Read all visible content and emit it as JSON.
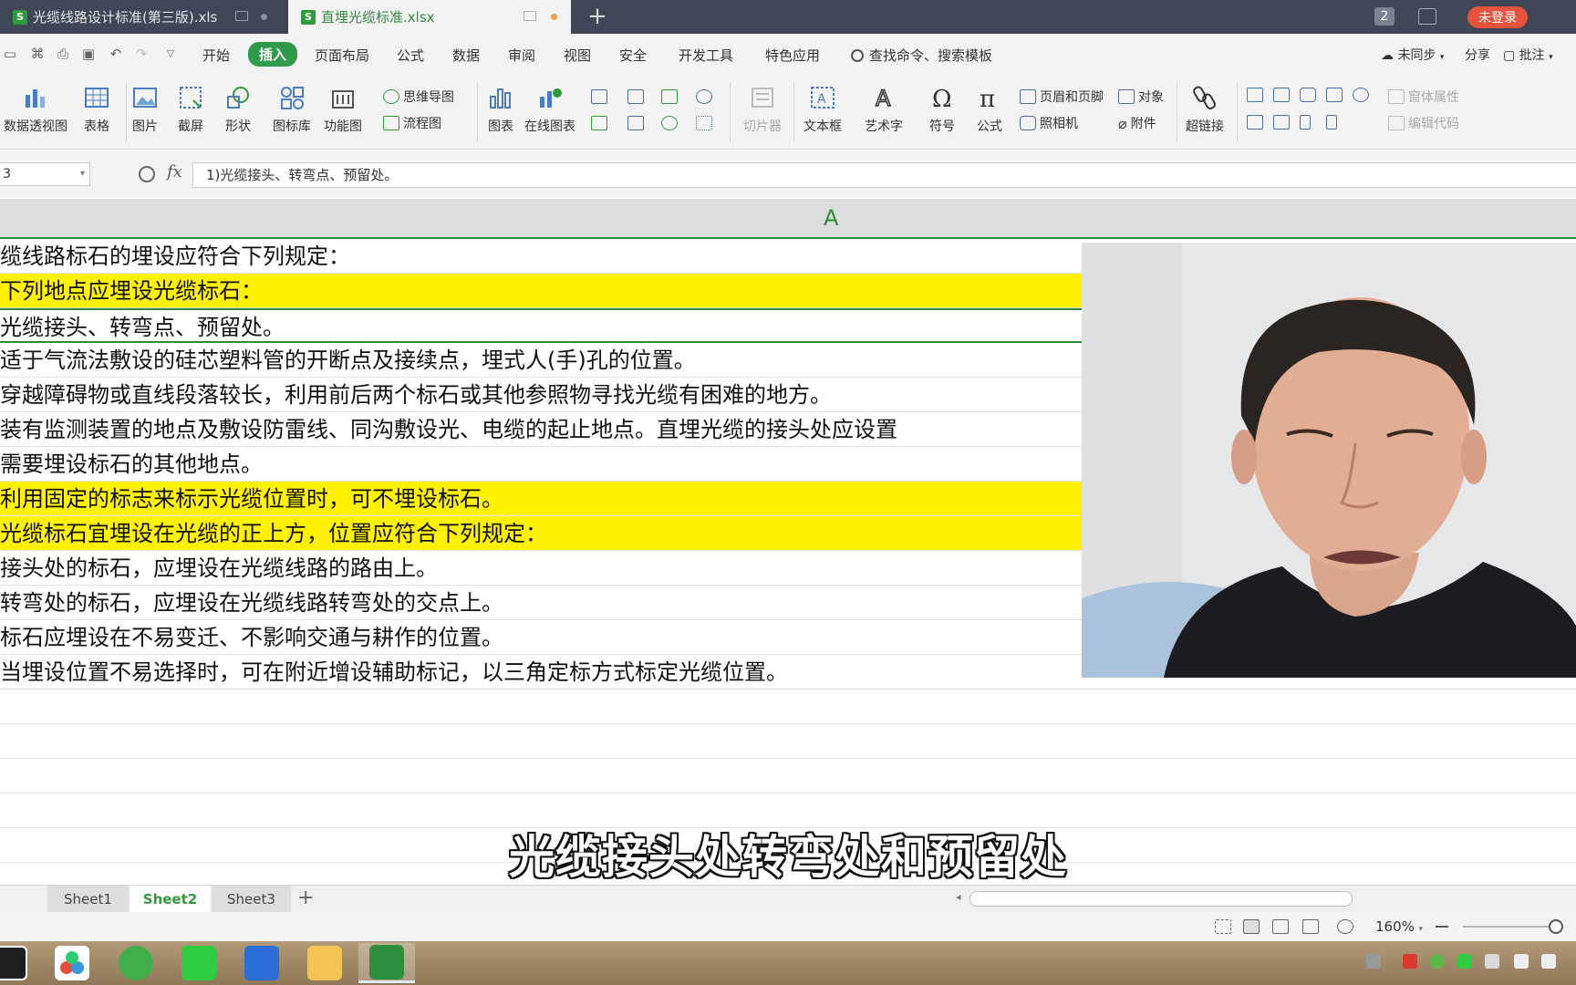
{
  "titlebar": {
    "tabs": [
      {
        "label": "光缆线路设计标准(第三版).xls",
        "icon": "S"
      },
      {
        "label": "直埋光缆标准.xlsx",
        "icon": "S"
      }
    ],
    "window_count": "2",
    "login_label": "未登录"
  },
  "menubar": {
    "items": [
      "开始",
      "插入",
      "页面布局",
      "公式",
      "数据",
      "审阅",
      "视图",
      "安全",
      "开发工具",
      "特色应用"
    ],
    "active": "插入",
    "search_label": "查找命令、搜索模板",
    "sync_label": "未同步",
    "share_label": "分享",
    "comment_label": "批注"
  },
  "ribbon": {
    "pivot": "数据透视图",
    "table": "表格",
    "picture": "图片",
    "screenshot": "截屏",
    "shapes": "形状",
    "icon_lib": "图标库",
    "func_chart": "功能图",
    "mindmap": "思维导图",
    "flowchart": "流程图",
    "chart": "图表",
    "online_chart": "在线图表",
    "slicer": "切片器",
    "textbox": "文本框",
    "wordart": "艺术字",
    "symbol": "符号",
    "formula": "公式",
    "header_footer": "页眉和页脚",
    "object": "对象",
    "camera": "照相机",
    "attachment": "附件",
    "hyperlink": "超链接",
    "form_props": "窗体属性",
    "edit_code": "编辑代码"
  },
  "formula_bar": {
    "cell_ref": "3",
    "fx": "fx",
    "content": "1)光缆接头、转弯点、预留处。"
  },
  "sheet": {
    "column_header": "A",
    "rows": [
      {
        "text": "缆线路标石的埋设应符合下列规定：",
        "highlight": false
      },
      {
        "text": "下列地点应埋设光缆标石：",
        "highlight": true
      },
      {
        "text": " 光缆接头、转弯点、预留处。",
        "highlight": false,
        "selected": true
      },
      {
        "text": " 适于气流法敷设的硅芯塑料管的开断点及接续点，埋式人(手)孔的位置。",
        "highlight": false
      },
      {
        "text": " 穿越障碍物或直线段落较长，利用前后两个标石或其他参照物寻找光缆有困难的地方。",
        "highlight": false
      },
      {
        "text": " 装有监测装置的地点及敷设防雷线、同沟敷设光、电缆的起止地点。直埋光缆的接头处应设置",
        "highlight": false
      },
      {
        "text": " 需要埋设标石的其他地点。",
        "highlight": false
      },
      {
        "text": "利用固定的标志来标示光缆位置时，可不埋设标石。",
        "highlight": true
      },
      {
        "text": "光缆标石宜埋设在光缆的正上方，位置应符合下列规定：",
        "highlight": true
      },
      {
        "text": " 接头处的标石，应埋设在光缆线路的路由上。",
        "highlight": false
      },
      {
        "text": " 转弯处的标石，应埋设在光缆线路转弯处的交点上。",
        "highlight": false
      },
      {
        "text": " 标石应埋设在不易变迁、不影响交通与耕作的位置。",
        "highlight": false
      },
      {
        "text": " 当埋设位置不易选择时，可在附近增设辅助标记，以三角定标方式标定光缆位置。",
        "highlight": false
      },
      {
        "text": "",
        "highlight": false
      },
      {
        "text": "",
        "highlight": false
      },
      {
        "text": "",
        "highlight": false
      },
      {
        "text": "",
        "highlight": false
      },
      {
        "text": "",
        "highlight": false
      }
    ]
  },
  "subtitle": "光缆接头处转弯处和预留处",
  "sheet_tabs": [
    "Sheet1",
    "Sheet2",
    "Sheet3"
  ],
  "active_sheet": "Sheet2",
  "status": {
    "zoom": "160%"
  },
  "colors": {
    "accent": "#2f9a3a",
    "highlight": "#fff200",
    "titlebar": "#3f4756",
    "login": "#e5533d"
  }
}
